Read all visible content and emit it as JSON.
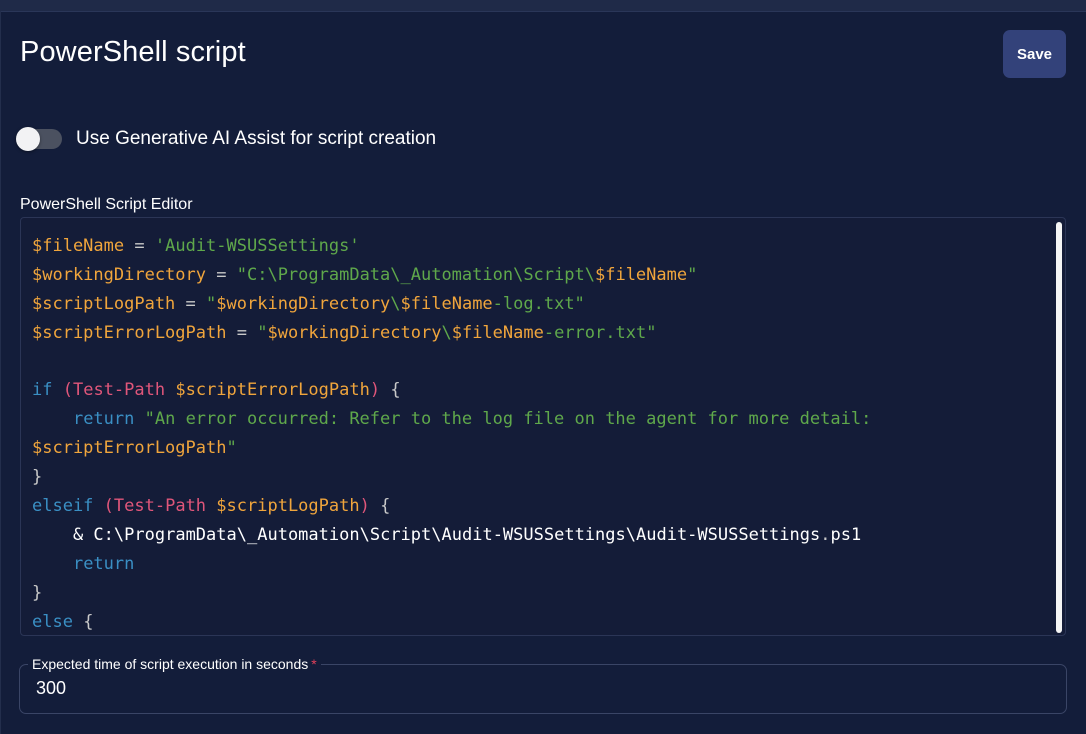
{
  "header": {
    "title": "PowerShell script",
    "save_label": "Save"
  },
  "ai_assist": {
    "label": "Use Generative AI Assist for script creation",
    "enabled": false
  },
  "editor": {
    "label": "PowerShell Script Editor",
    "language": "powershell",
    "lines": [
      "$fileName = 'Audit-WSUSSettings'",
      "$workingDirectory = \"C:\\ProgramData\\_Automation\\Script\\$fileName\"",
      "$scriptLogPath = \"$workingDirectory\\$fileName-log.txt\"",
      "$scriptErrorLogPath = \"$workingDirectory\\$fileName-error.txt\"",
      "",
      "if (Test-Path $scriptErrorLogPath) {",
      "    return \"An error occurred: Refer to the log file on the agent for more detail:",
      "$scriptErrorLogPath\"",
      "}",
      "elseif (Test-Path $scriptLogPath) {",
      "    & C:\\ProgramData\\_Automation\\Script\\Audit-WSUSSettings\\Audit-WSUSSettings.ps1",
      "    return",
      "}",
      "else {"
    ]
  },
  "execution_time": {
    "label": "Expected time of script execution in seconds",
    "required_mark": "*",
    "value": "300"
  },
  "colors": {
    "background": "#131d3a",
    "button": "#33427a",
    "variable": "#f0a53c",
    "string": "#5fa84b",
    "keyword": "#3a8fc4",
    "cmdlet": "#e0567a",
    "required": "#e0405a"
  }
}
